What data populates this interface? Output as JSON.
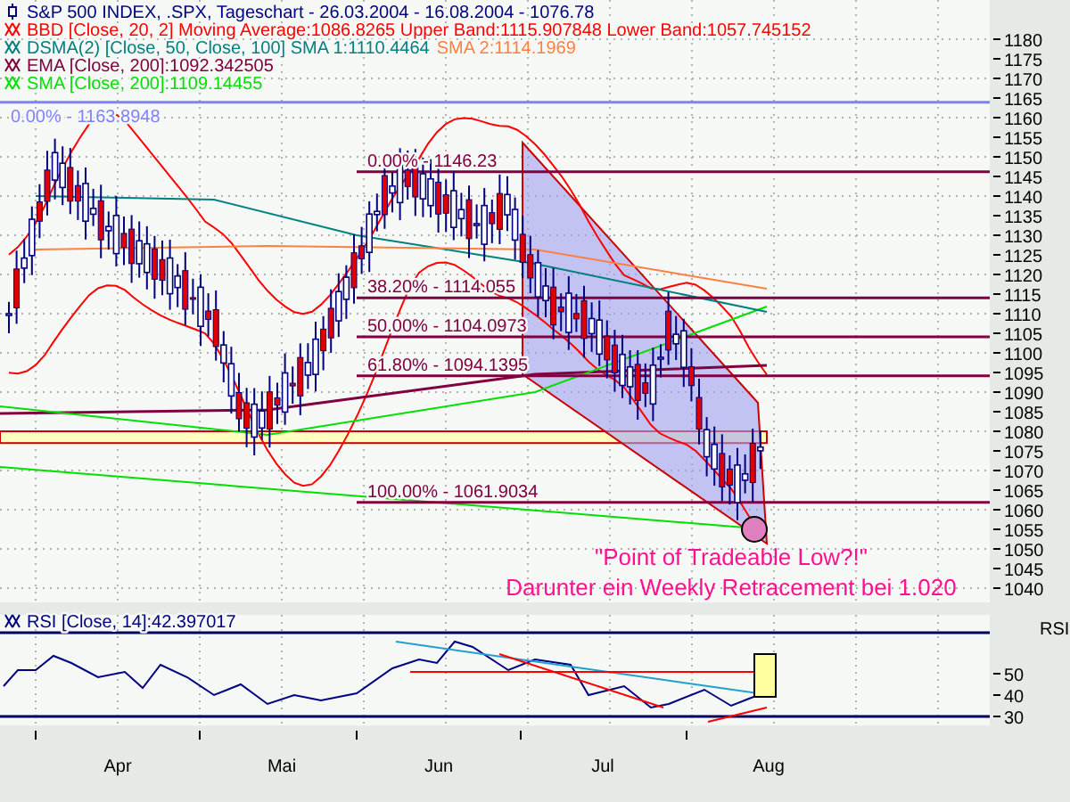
{
  "legend": [
    {
      "kind": "instrument",
      "segments": [
        {
          "text": "S&P 500 INDEX, .SPX, Tageschart - 26.03.2004 - 16.08.2004 - 1076.78",
          "color": "#000080"
        }
      ]
    },
    {
      "kind": "indicator",
      "segments": [
        {
          "text": "BBD [Close, 20, 2] Moving Average:1086.8265 Upper Band:1115.907848 Lower Band:1057.745152",
          "color": "#ff0000"
        }
      ]
    },
    {
      "kind": "indicator",
      "segments": [
        {
          "text": "DSMA(2) [Close, 50, Close, 100] SMA 1:1110.4464",
          "color": "#008080"
        },
        {
          "text": "SMA 2:1114.1969",
          "color": "#ff8040"
        }
      ]
    },
    {
      "kind": "indicator",
      "segments": [
        {
          "text": "EMA [Close, 200]:1092.342505",
          "color": "#800040"
        }
      ]
    },
    {
      "kind": "indicator",
      "segments": [
        {
          "text": "SMA [Close, 200]:1109.14455",
          "color": "#00e000"
        }
      ]
    }
  ],
  "price_axis": {
    "ticks": [
      "1180",
      "1175",
      "1170",
      "1165",
      "1160",
      "1155",
      "1150",
      "1145",
      "1140",
      "1135",
      "1130",
      "1125",
      "1120",
      "1115",
      "1110",
      "1105",
      "1100",
      "1095",
      "1090",
      "1085",
      "1080",
      "1075",
      "1070",
      "1065",
      "1060",
      "1055",
      "1050",
      "1045",
      "1040"
    ]
  },
  "fib_levels": [
    {
      "label": "0.00% - 1163.8948",
      "color": "#8080ff"
    },
    {
      "label": "0.00% - 1146.23",
      "color": "#800040"
    },
    {
      "label": "38.20% - 1114.055",
      "color": "#800040"
    },
    {
      "label": "50.00% - 1104.0973",
      "color": "#800040"
    },
    {
      "label": "61.80% - 1094.1395",
      "color": "#800040"
    },
    {
      "label": "100.00% - 1061.9034",
      "color": "#800040"
    }
  ],
  "annotations": [
    "\"Point of Tradeable Low?!\"",
    "Darunter ein Weekly Retracement bei 1.020"
  ],
  "rsi": {
    "legend": "RSI [Close, 14]:42.397017",
    "axis_label": "RSI",
    "ticks": [
      "50",
      "40",
      "30"
    ]
  },
  "months": [
    "Apr",
    "Mai",
    "Jun",
    "Jul",
    "Aug"
  ]
}
